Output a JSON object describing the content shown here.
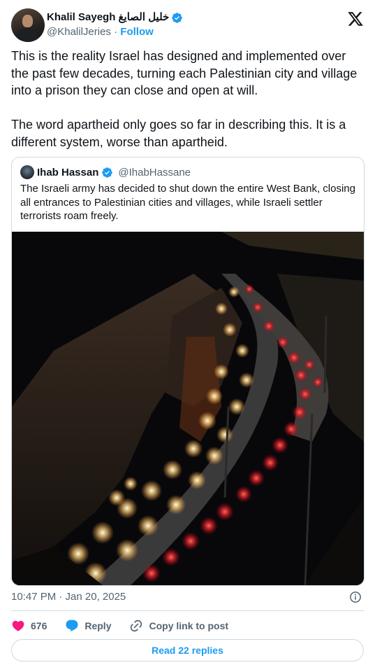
{
  "author": {
    "display_name": "Khalil Sayegh خليل الصايغ",
    "handle": "@KhalilJeries",
    "separator": "·",
    "follow_label": "Follow"
  },
  "tweet_text": "This is the reality Israel has designed and implemented over the past few decades, turning each Palestinian city and village into a prison they can close and open at will.\n\nThe word apartheid only goes so far in describing this. It is a different system, worse than apartheid.",
  "quote": {
    "display_name": "Ihab Hassan",
    "handle": "@IhabHassane",
    "text": "The Israeli army has decided to shut down the entire West Bank, closing all entrances to Palestinian cities and villages, while Israeli settler terrorists roam freely."
  },
  "timestamp": "10:47 PM · Jan 20, 2025",
  "actions": {
    "like_count": "676",
    "reply_label": "Reply",
    "copy_label": "Copy link to post"
  },
  "read_replies_label": "Read 22 replies",
  "colors": {
    "accent": "#1d9bf0",
    "like": "#f91880",
    "text": "#0f1419",
    "muted": "#536471"
  },
  "icons": [
    "verified-badge-icon",
    "x-logo-icon",
    "info-icon",
    "heart-icon",
    "reply-icon",
    "link-icon"
  ]
}
